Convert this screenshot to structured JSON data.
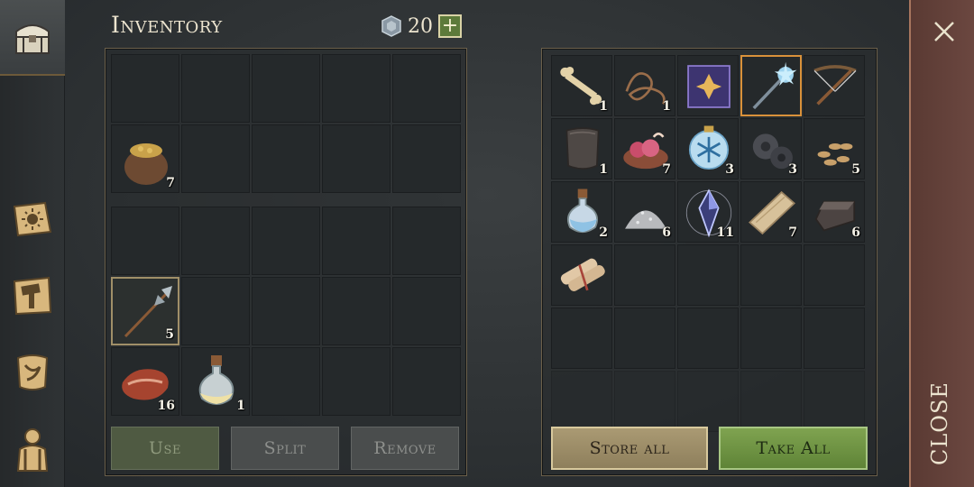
{
  "header": {
    "title": "Inventory",
    "currency_value": "20",
    "plus_label": "+"
  },
  "nav": {
    "tabs": [
      {
        "name": "chest",
        "icon": "chest-icon",
        "active": true
      },
      {
        "name": "skills",
        "icon": "sun-book-icon"
      },
      {
        "name": "crafting",
        "icon": "hammer-icon"
      },
      {
        "name": "map",
        "icon": "scroll-icon"
      },
      {
        "name": "character",
        "icon": "backpack-figure-icon"
      }
    ]
  },
  "left": {
    "pockets": [
      {
        "icon": ""
      },
      {
        "icon": ""
      },
      {
        "icon": ""
      },
      {
        "icon": ""
      },
      {
        "icon": ""
      },
      {
        "icon": "grain-sack-icon",
        "qty": "7"
      },
      {
        "icon": ""
      },
      {
        "icon": ""
      },
      {
        "icon": ""
      },
      {
        "icon": ""
      }
    ],
    "backpack": [
      {
        "icon": ""
      },
      {
        "icon": ""
      },
      {
        "icon": ""
      },
      {
        "icon": ""
      },
      {
        "icon": ""
      },
      {
        "icon": "halberd-icon",
        "qty": "5",
        "selected": true
      },
      {
        "icon": ""
      },
      {
        "icon": ""
      },
      {
        "icon": ""
      },
      {
        "icon": ""
      },
      {
        "icon": "raw-meat-icon",
        "qty": "16"
      },
      {
        "icon": "potion-flask-icon",
        "qty": "1"
      },
      {
        "icon": ""
      },
      {
        "icon": ""
      },
      {
        "icon": ""
      }
    ],
    "buttons": {
      "use": "Use",
      "split": "Split",
      "remove": "Remove"
    }
  },
  "storage": {
    "items": [
      {
        "icon": "bone-icon",
        "qty": "1"
      },
      {
        "icon": "rope-icon",
        "qty": "1"
      },
      {
        "icon": "spellbook-icon",
        "qty": ""
      },
      {
        "icon": "ice-mace-icon",
        "qty": "",
        "highlight": true
      },
      {
        "icon": "crossbow-icon",
        "qty": ""
      },
      {
        "icon": "leather-armor-icon",
        "qty": "1"
      },
      {
        "icon": "meat-bowl-icon",
        "qty": "7"
      },
      {
        "icon": "frost-orb-icon",
        "qty": "3"
      },
      {
        "icon": "gear-cogs-icon",
        "qty": "3"
      },
      {
        "icon": "seeds-icon",
        "qty": "5"
      },
      {
        "icon": "water-flask-icon",
        "qty": "2"
      },
      {
        "icon": "salt-pile-icon",
        "qty": "6"
      },
      {
        "icon": "magic-crystal-icon",
        "qty": "11"
      },
      {
        "icon": "wood-plank-icon",
        "qty": "7"
      },
      {
        "icon": "iron-ingot-icon",
        "qty": "6"
      },
      {
        "icon": "scroll-bundle-icon",
        "qty": ""
      }
    ],
    "buttons": {
      "store_all": "Store all",
      "take_all": "Take All"
    }
  },
  "close": {
    "label": "CLOSE"
  },
  "colors": {
    "accent_green": "#6f9443",
    "accent_tan": "#a08f68",
    "close_red": "#6b4740"
  }
}
